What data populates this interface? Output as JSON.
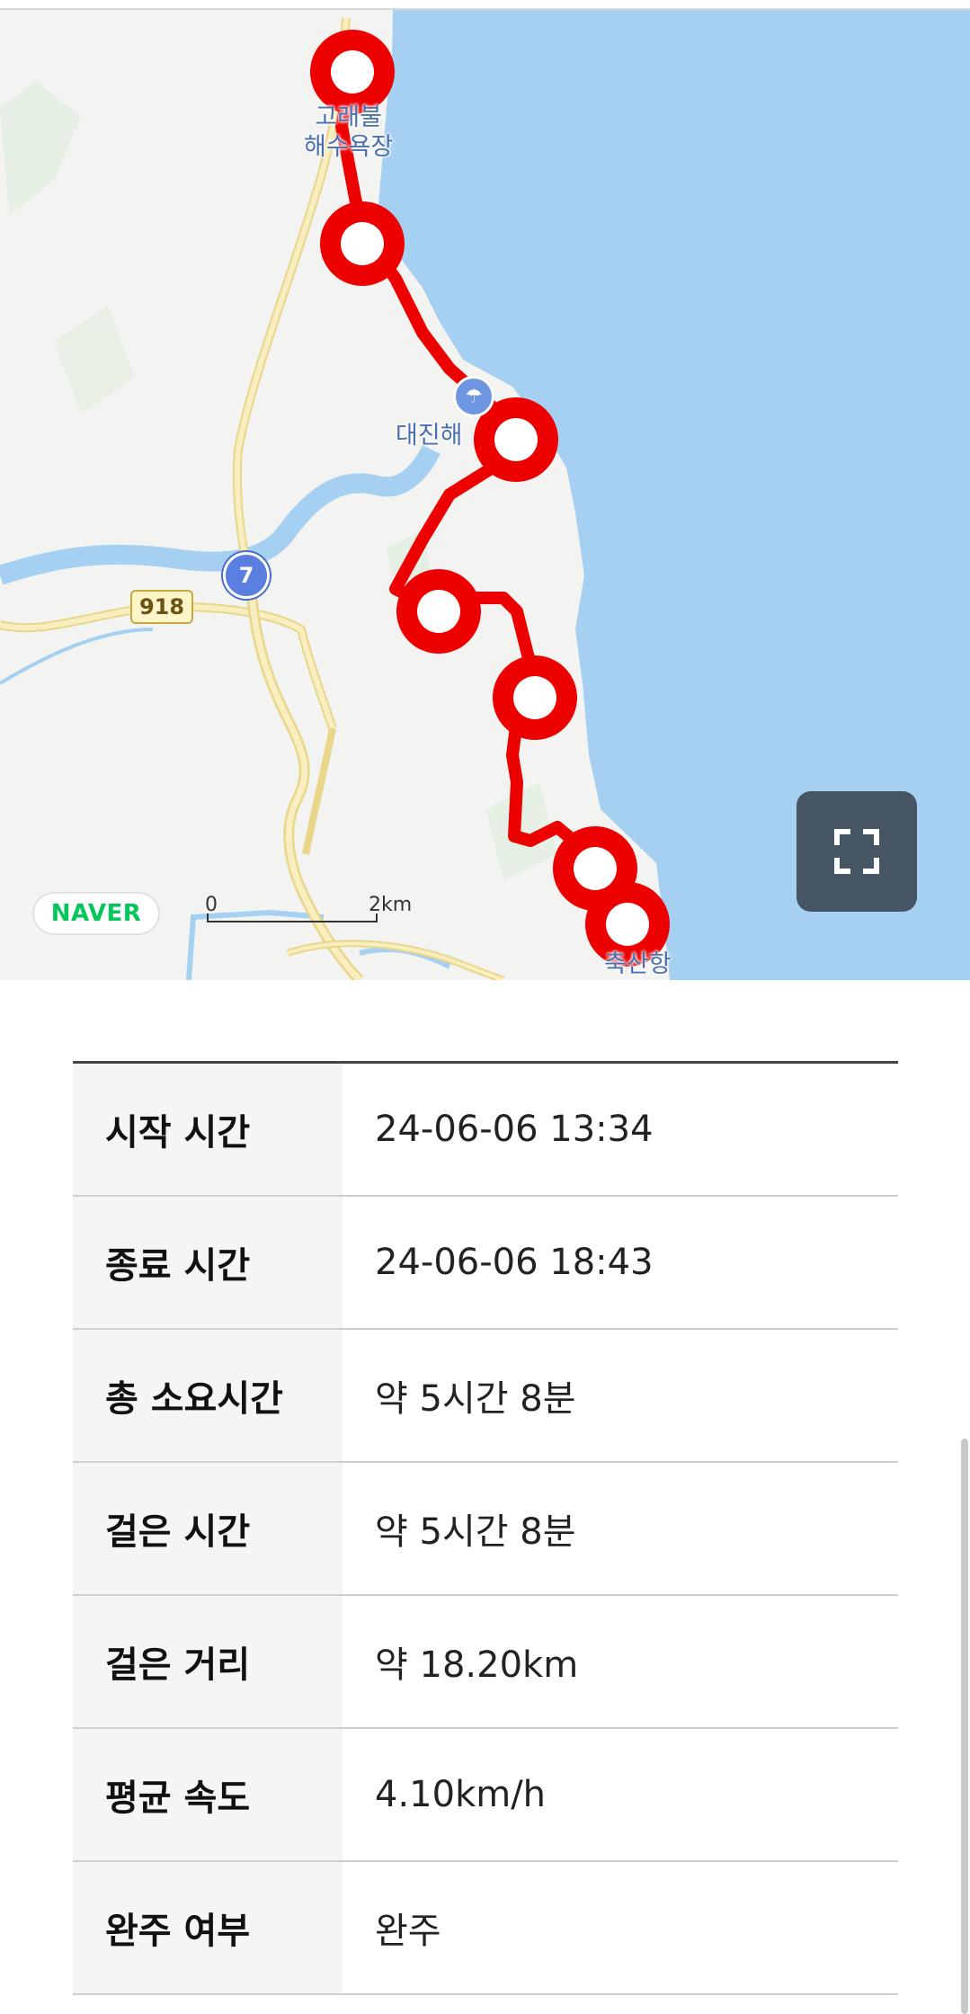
{
  "map": {
    "labels": {
      "gorae_line1": "고래불",
      "gorae_line2": "해수욕장",
      "daejin": "대진해",
      "chuksan": "축산항"
    },
    "route_badge": "7",
    "road_number": "918",
    "naver_logo": "NAVER",
    "scale": {
      "start": "0",
      "end": "2km"
    },
    "fullscreen_icon": "fullscreen-icon",
    "beach_icon": "beach-umbrella-icon",
    "colors": {
      "sea": "#a6d0f2",
      "route": "#ec0000",
      "land": "#f3f4f2",
      "road": "#f7e6a5",
      "river": "#a6d0f2"
    }
  },
  "table": {
    "rows": [
      {
        "label": "시작 시간",
        "value": "24-06-06 13:34"
      },
      {
        "label": "종료 시간",
        "value": "24-06-06 18:43"
      },
      {
        "label": "총 소요시간",
        "value": "약 5시간 8분"
      },
      {
        "label": "걸은 시간",
        "value": "약 5시간 8분"
      },
      {
        "label": "걸은 거리",
        "value": "약 18.20km"
      },
      {
        "label": "평균 속도",
        "value": "4.10km/h"
      },
      {
        "label": "완주 여부",
        "value": "완주"
      }
    ]
  }
}
